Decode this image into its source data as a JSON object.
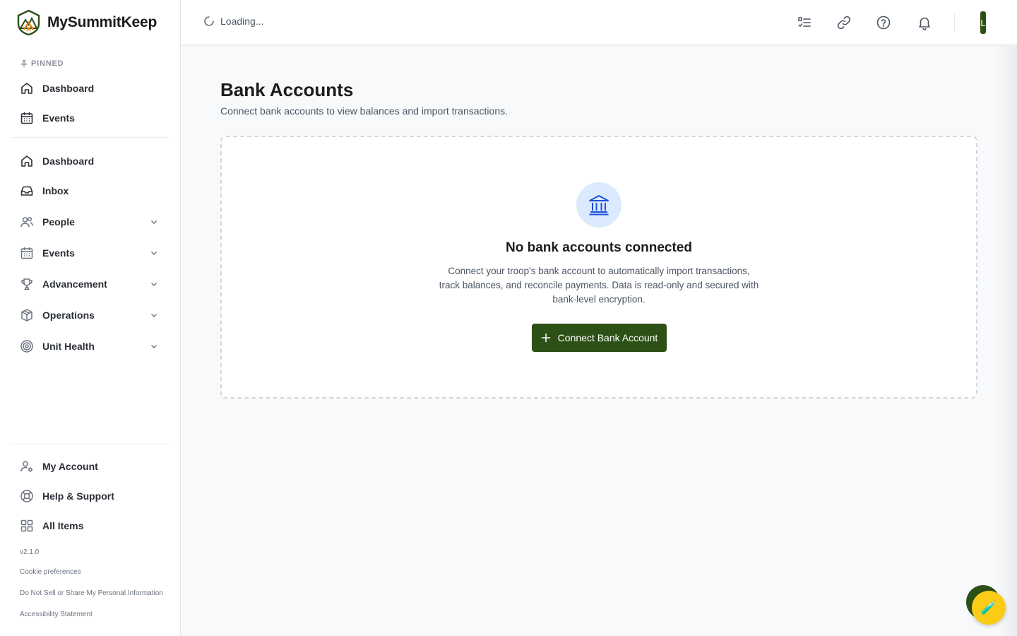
{
  "app": {
    "name": "MySummitKeep",
    "brand_color": "#2d5016"
  },
  "sidebar": {
    "pinned_label": "PINNED",
    "pinned": [
      {
        "label": "Dashboard",
        "icon": "home-icon"
      },
      {
        "label": "Events",
        "icon": "calendar-icon"
      }
    ],
    "main": [
      {
        "label": "Dashboard",
        "icon": "home-icon",
        "expandable": false
      },
      {
        "label": "Inbox",
        "icon": "inbox-icon",
        "expandable": false
      },
      {
        "label": "People",
        "icon": "users-icon",
        "expandable": true
      },
      {
        "label": "Events",
        "icon": "calendar-icon",
        "expandable": true
      },
      {
        "label": "Advancement",
        "icon": "trophy-icon",
        "expandable": true
      },
      {
        "label": "Operations",
        "icon": "box-icon",
        "expandable": true
      },
      {
        "label": "Unit Health",
        "icon": "target-icon",
        "expandable": true
      }
    ],
    "bottom": [
      {
        "label": "My Account",
        "icon": "user-gear-icon"
      },
      {
        "label": "Help & Support",
        "icon": "lifebuoy-icon"
      },
      {
        "label": "All Items",
        "icon": "grid-icon"
      }
    ],
    "version": "v2.1.0",
    "footer_links": [
      "Cookie preferences",
      "Do Not Sell or Share My Personal Information",
      "Accessibility Statement"
    ]
  },
  "topbar": {
    "loading_text": "Loading...",
    "avatar_initial": "L",
    "icons": [
      "checklist-icon",
      "link-icon",
      "help-icon",
      "bell-icon"
    ]
  },
  "page": {
    "title": "Bank Accounts",
    "subtitle": "Connect bank accounts to view balances and import transactions.",
    "empty_state": {
      "icon": "bank-icon",
      "title": "No bank accounts connected",
      "description": "Connect your troop's bank account to automatically import transactions, track balances, and reconcile payments. Data is read-only and secured with bank-level encryption.",
      "button_label": "Connect Bank Account"
    }
  },
  "fab": {
    "icon": "test-tube-icon",
    "glyph": "🧪"
  }
}
